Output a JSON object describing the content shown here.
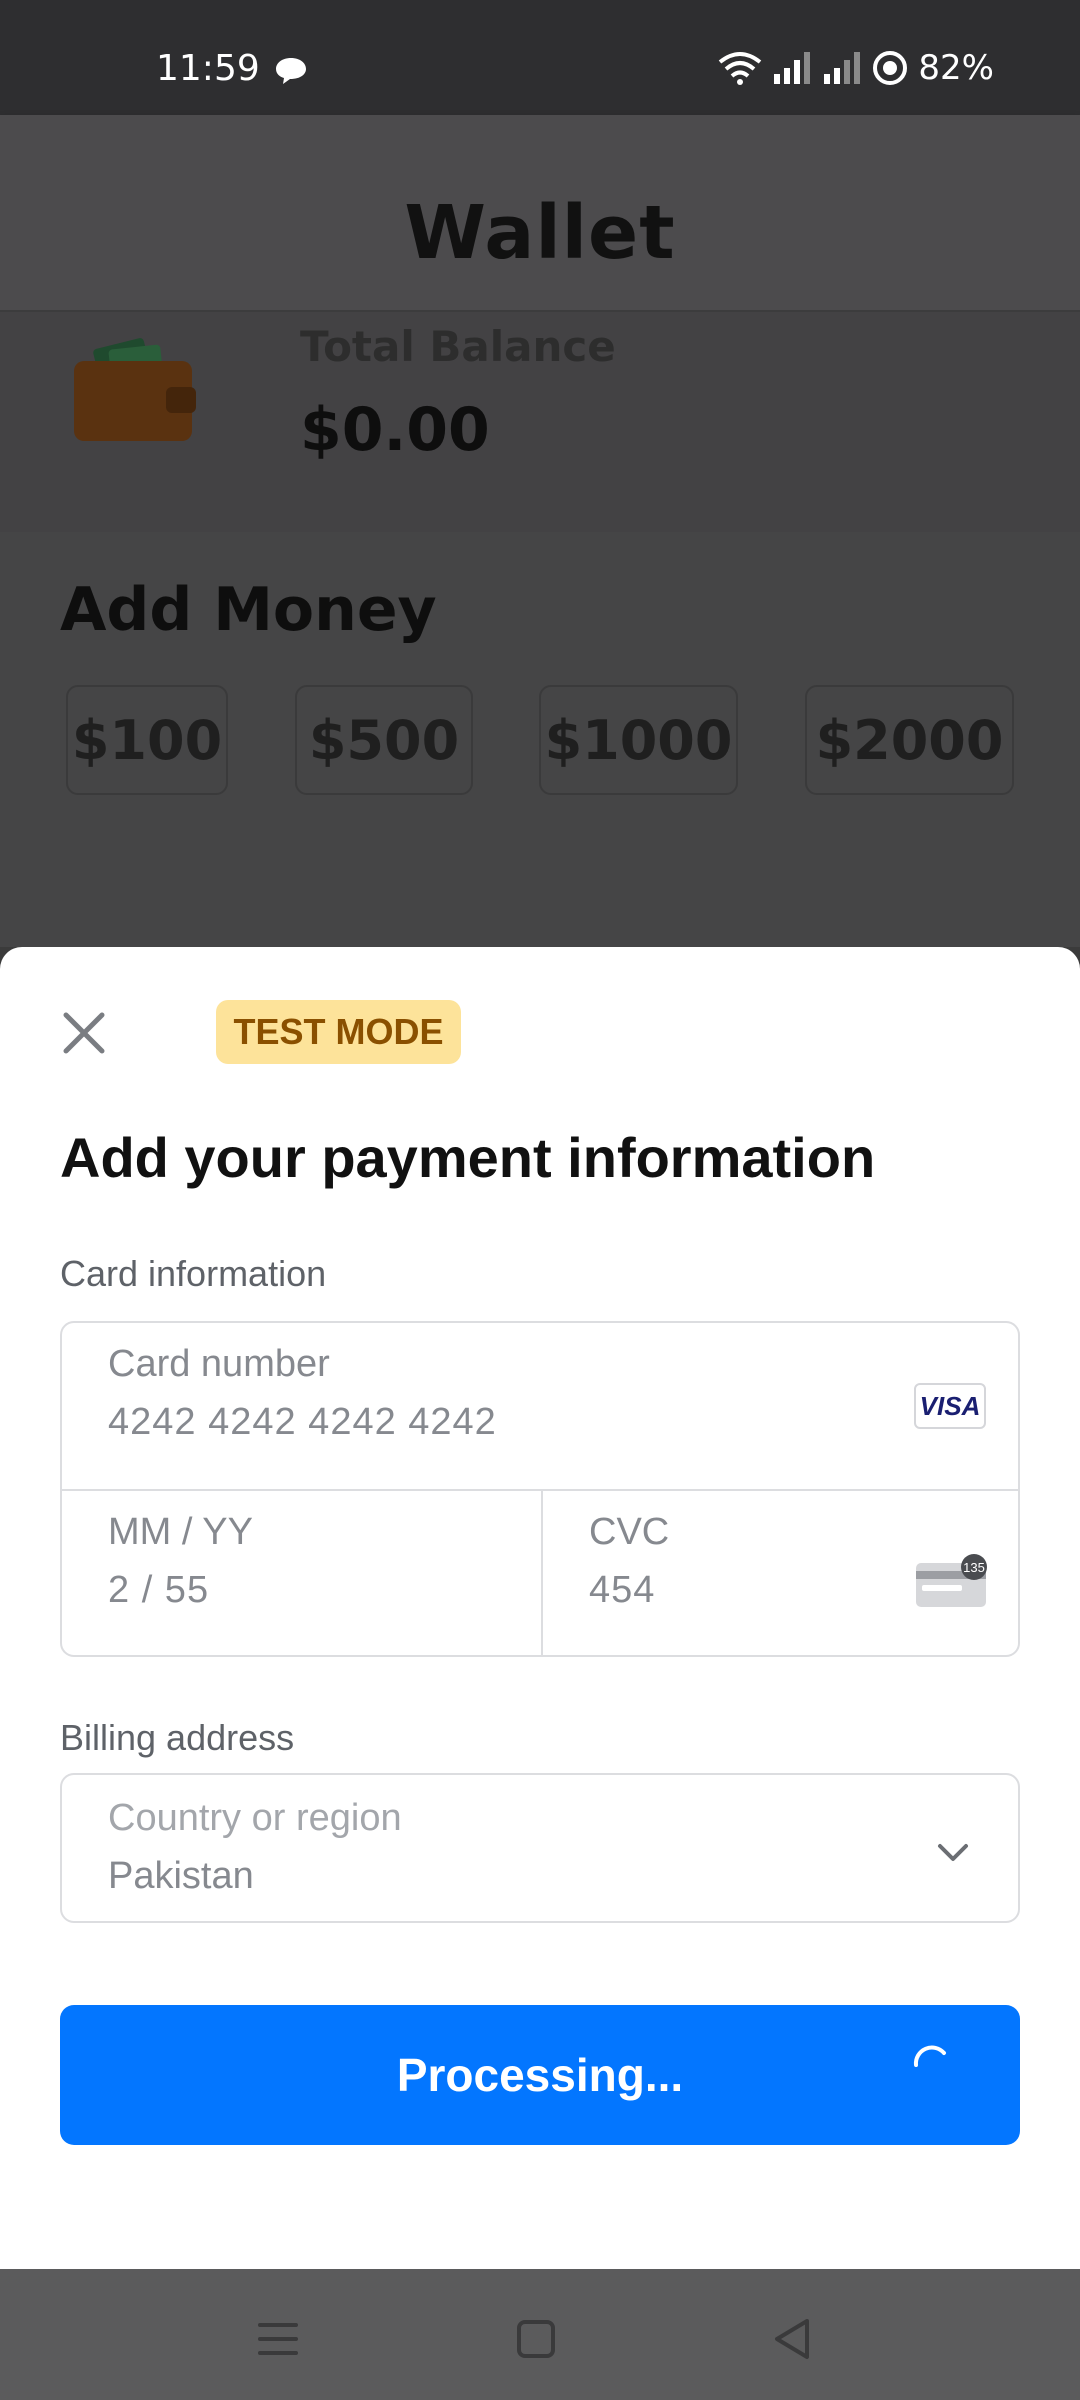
{
  "status_bar": {
    "time": "11:59",
    "battery": "82%",
    "icons": [
      "chat-bubble-icon",
      "wifi-icon",
      "signal-icon",
      "signal-icon",
      "target-icon"
    ]
  },
  "app": {
    "title": "Wallet",
    "balance_label": "Total Balance",
    "balance_value": "$0.00",
    "add_money_title": "Add Money",
    "amounts": [
      "$100",
      "$500",
      "$1000",
      "$2000"
    ]
  },
  "sheet": {
    "badge": "TEST MODE",
    "title": "Add your payment information",
    "card_section_label": "Card information",
    "card_number_label": "Card number",
    "card_number_value": "4242 4242 4242 4242",
    "card_brand": "VISA",
    "expiry_label": "MM / YY",
    "expiry_value": "2 / 55",
    "cvc_label": "CVC",
    "cvc_value": "454",
    "cvc_badge": "135",
    "billing_section_label": "Billing address",
    "country_label": "Country or region",
    "country_value": "Pakistan",
    "pay_button": "Processing...",
    "accent_color": "#0376ff"
  },
  "nav_bar": {
    "buttons": [
      "menu-icon",
      "home-square-icon",
      "back-triangle-icon"
    ]
  }
}
